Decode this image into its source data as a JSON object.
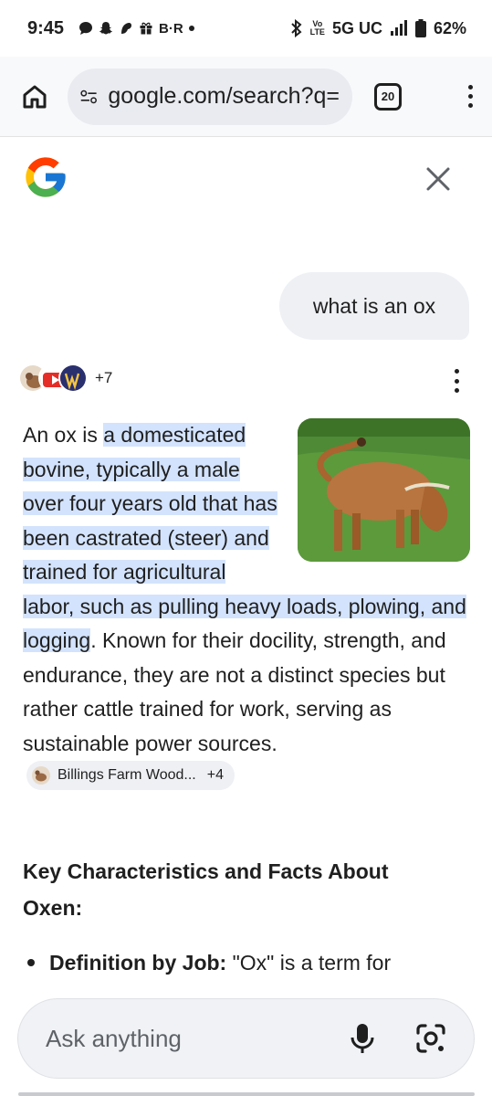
{
  "status_bar": {
    "time": "9:45",
    "carrier_badge": "B·R",
    "volte_top": "Vo",
    "volte_bottom": "LTE",
    "network": "5G UC",
    "battery": "62%"
  },
  "toolbar": {
    "url": "google.com/search?q=",
    "tab_count": "20"
  },
  "query": "what is an ox",
  "sources": {
    "more_count": "+7"
  },
  "answer": {
    "intro": "An ox is ",
    "highlighted": "a domesticated bovine, typically a male over four years old that has been castrated (steer) and trained for agricultural labor, such as pulling heavy loads, plowing, and logging",
    "rest": ". Known for their docility, strength, and endurance, they are not a distinct species but rather cattle trained for work, serving as sustainable power sources.",
    "chip_label": "Billings Farm Wood...",
    "chip_count": "+4"
  },
  "section_heading": "Key Characteristics and Facts About Oxen:",
  "bullets": [
    {
      "bold": "Definition by Job:",
      "text": " \"Ox\" is a term for"
    }
  ],
  "ask_bar": {
    "placeholder": "Ask anything"
  },
  "colors": {
    "highlight": "#d3e3fd",
    "chip_bg": "#eef0f4",
    "bubble_bg": "#eef0f4",
    "google_blue": "#4285F4",
    "google_red": "#EA4335",
    "google_yellow": "#FBBC05",
    "google_green": "#34A853"
  }
}
